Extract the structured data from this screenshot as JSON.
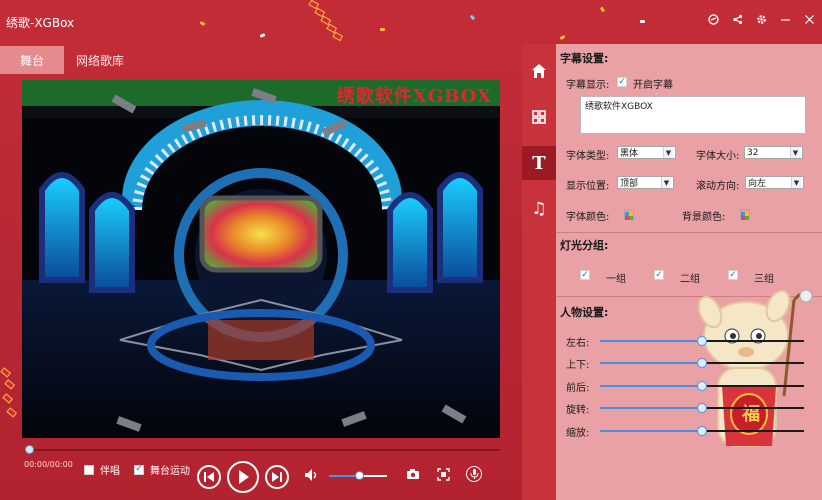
{
  "app": {
    "title": "绣歌-XGBox"
  },
  "titlebar": {
    "icons": [
      "skin-icon",
      "share-icon",
      "settings-icon",
      "minimize-icon",
      "close-icon"
    ]
  },
  "tabs": [
    {
      "label": "舞台",
      "active": true
    },
    {
      "label": "网络歌库",
      "active": false
    }
  ],
  "video": {
    "watermark": "绣歌软件XGBOX"
  },
  "player": {
    "time": "00:00/00:00",
    "accompany_label": "伴唱",
    "accompany_checked": false,
    "stage_motion_label": "舞台运动",
    "stage_motion_checked": true,
    "volume": 0.5
  },
  "sidebar": {
    "items": [
      {
        "name": "home-icon",
        "active": false
      },
      {
        "name": "grid-icon",
        "active": false
      },
      {
        "name": "text-icon",
        "active": true
      },
      {
        "name": "music-icon",
        "active": false
      }
    ]
  },
  "subtitle": {
    "section_title": "字幕设置:",
    "display_label": "字幕显示:",
    "enable_label": "开启字幕",
    "enabled": true,
    "text": "绣歌软件XGBOX",
    "font_type_label": "字体类型:",
    "font_type_value": "黑体",
    "font_size_label": "字体大小:",
    "font_size_value": "32",
    "position_label": "显示位置:",
    "position_value": "顶部",
    "scroll_label": "滚动方向:",
    "scroll_value": "向左",
    "font_color_label": "字体颜色:",
    "bg_color_label": "背景颜色:"
  },
  "lights": {
    "section_title": "灯光分组:",
    "groups": [
      {
        "label": "一组",
        "checked": true
      },
      {
        "label": "二组",
        "checked": true
      },
      {
        "label": "三组",
        "checked": true
      }
    ]
  },
  "character": {
    "section_title": "人物设置:",
    "sliders": [
      {
        "label": "左右:",
        "value": 0.5
      },
      {
        "label": "上下:",
        "value": 0.5
      },
      {
        "label": "前后:",
        "value": 0.5
      },
      {
        "label": "旋转:",
        "value": 0.5
      },
      {
        "label": "缩放:",
        "value": 0.5
      }
    ],
    "mascot_badge": "福"
  },
  "colors": {
    "accent": "#4a90e2",
    "brand_red": "#c42d37",
    "panel_pink": "#e9a1a5",
    "watermark_red": "#e0262e"
  }
}
